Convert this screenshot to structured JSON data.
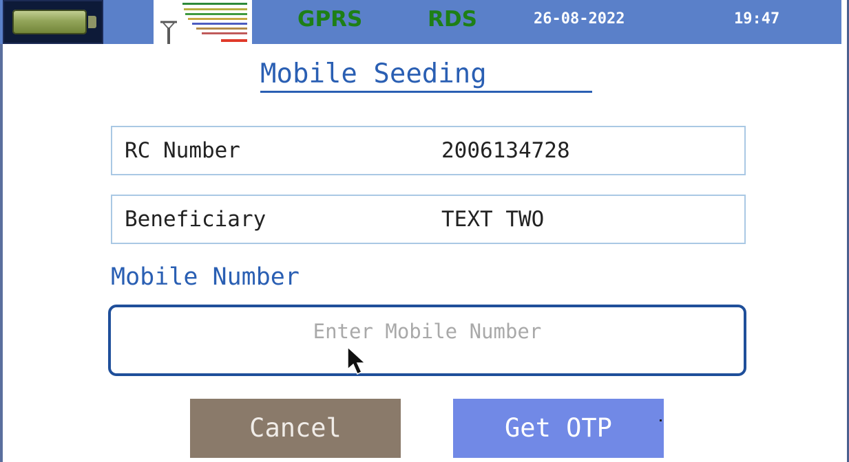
{
  "status_bar": {
    "network": "GPRS",
    "service": "RDS",
    "date": "26-08-2022",
    "time": "19:47",
    "icons": [
      "battery-icon",
      "signal-strength-icon"
    ],
    "colors": {
      "bar_background": "#5a80c9",
      "network_text": "#1e7f16"
    }
  },
  "page": {
    "title": "Mobile Seeding"
  },
  "info": {
    "rc_label": "RC Number",
    "rc_value": "2006134728",
    "beneficiary_label": "Beneficiary",
    "beneficiary_value": "TEXT TWO"
  },
  "mobile": {
    "label": "Mobile Number",
    "placeholder": "Enter Mobile Number",
    "value": ""
  },
  "buttons": {
    "cancel": "Cancel",
    "get_otp": "Get OTP"
  },
  "colors": {
    "accent": "#2a5fb3",
    "cancel_button": "#8a7a6a",
    "otp_button": "#7189e6",
    "input_border": "#1f4f9a"
  }
}
